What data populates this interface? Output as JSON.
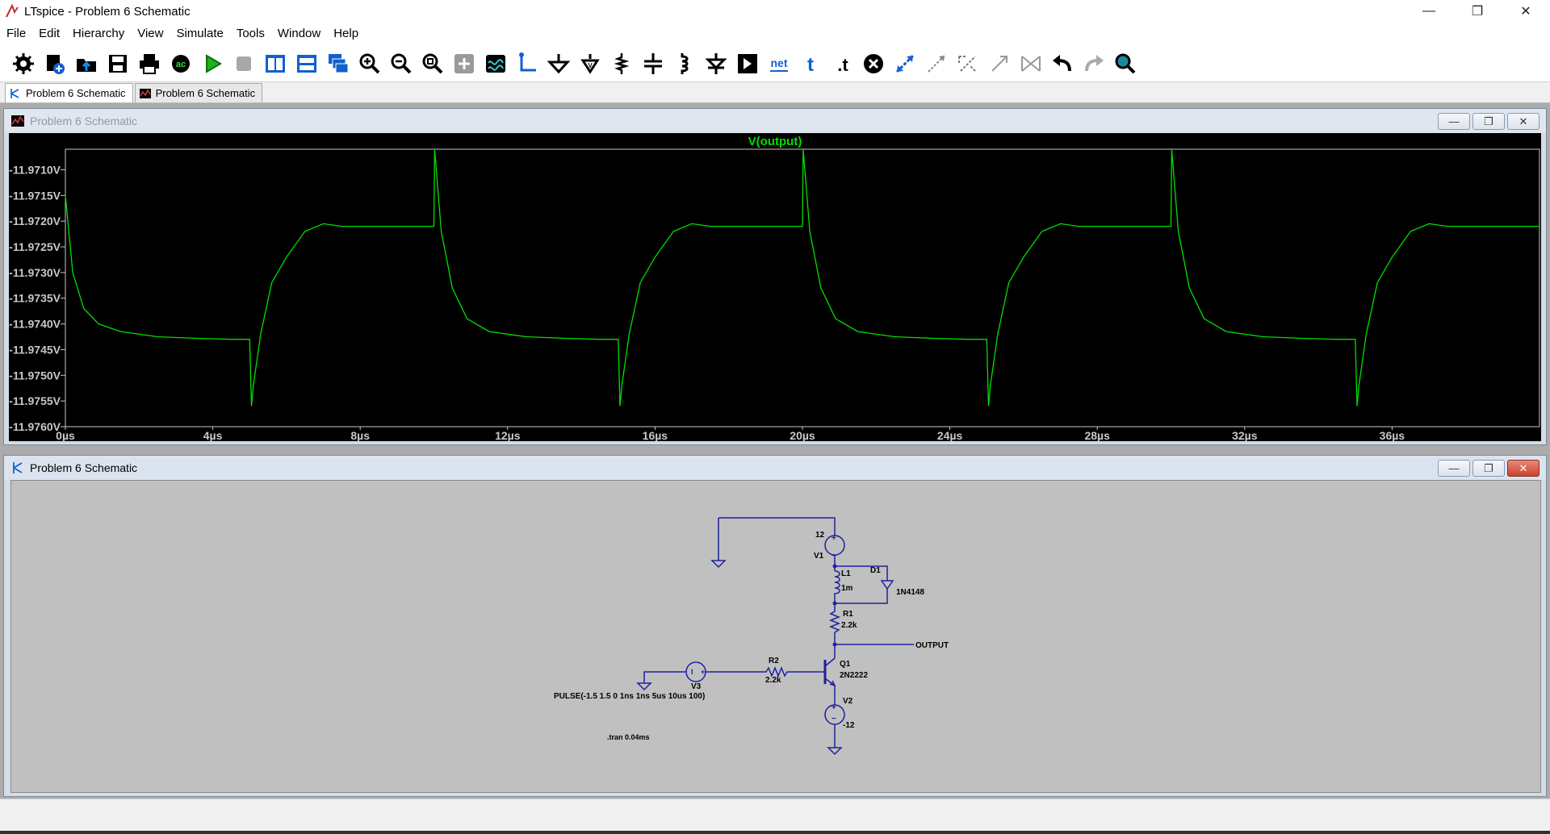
{
  "window": {
    "title": "LTspice - Problem 6 Schematic"
  },
  "menu": [
    "File",
    "Edit",
    "Hierarchy",
    "View",
    "Simulate",
    "Tools",
    "Window",
    "Help"
  ],
  "toolbar": [
    {
      "name": "settings-icon"
    },
    {
      "name": "new-schematic-icon"
    },
    {
      "name": "open-icon"
    },
    {
      "name": "save-icon"
    },
    {
      "name": "print-icon"
    },
    {
      "name": "ac-analysis-icon"
    },
    {
      "name": "run-icon"
    },
    {
      "name": "halt-icon"
    },
    {
      "name": "tile-vertical-icon"
    },
    {
      "name": "tile-horizontal-icon"
    },
    {
      "name": "cascade-icon"
    },
    {
      "name": "zoom-in-icon"
    },
    {
      "name": "zoom-out-icon"
    },
    {
      "name": "zoom-fit-icon"
    },
    {
      "name": "pan-icon"
    },
    {
      "name": "autorange-icon"
    },
    {
      "name": "wire-icon"
    },
    {
      "name": "ground-icon"
    },
    {
      "name": "label-net-icon"
    },
    {
      "name": "resistor-icon"
    },
    {
      "name": "capacitor-icon"
    },
    {
      "name": "inductor-icon"
    },
    {
      "name": "diode-icon"
    },
    {
      "name": "component-icon"
    },
    {
      "name": "net-icon"
    },
    {
      "name": "text-icon"
    },
    {
      "name": "spice-directive-icon"
    },
    {
      "name": "delete-icon"
    },
    {
      "name": "move-icon"
    },
    {
      "name": "drag-icon"
    },
    {
      "name": "rotate-icon"
    },
    {
      "name": "mirror-icon"
    },
    {
      "name": "paste-icon"
    },
    {
      "name": "undo-icon"
    },
    {
      "name": "redo-icon"
    },
    {
      "name": "find-icon"
    }
  ],
  "tabs": [
    {
      "label": "Problem 6 Schematic",
      "kind": "schematic"
    },
    {
      "label": "Problem 6 Schematic",
      "kind": "waveform"
    }
  ],
  "plot_window": {
    "title": "Problem 6 Schematic"
  },
  "schematic_window": {
    "title": "Problem 6 Schematic"
  },
  "chart_data": {
    "type": "line",
    "title": "V(output)",
    "series_color": "#00e000",
    "x_ticks": [
      "0µs",
      "4µs",
      "8µs",
      "12µs",
      "16µs",
      "20µs",
      "24µs",
      "28µs",
      "32µs",
      "36µs"
    ],
    "y_ticks": [
      "-11.9710V",
      "-11.9715V",
      "-11.9720V",
      "-11.9725V",
      "-11.9730V",
      "-11.9735V",
      "-11.9740V",
      "-11.9745V",
      "-11.9750V",
      "-11.9755V",
      "-11.9760V"
    ],
    "xlim": [
      0,
      40
    ],
    "ylim": [
      -11.976,
      -11.9706
    ],
    "series": [
      {
        "x": [
          0,
          0.2,
          0.5,
          0.9,
          1.5,
          2.5,
          3.5,
          4.5,
          5.0,
          5.05,
          5.1,
          5.3,
          5.6,
          6.0,
          6.5,
          7.0,
          7.5,
          8.0,
          9.0,
          10.0,
          10.02,
          10.2,
          10.5,
          10.9,
          11.5,
          12.5,
          13.5,
          14.5,
          15.0,
          15.05,
          15.1,
          15.3,
          15.6,
          16.0,
          16.5,
          17.0,
          17.5,
          18.0,
          19.0,
          20.0,
          20.02,
          20.2,
          20.5,
          20.9,
          21.5,
          22.5,
          23.5,
          24.5,
          25.0,
          25.05,
          25.1,
          25.3,
          25.6,
          26.0,
          26.5,
          27.0,
          27.5,
          28.0,
          29.0,
          30.0,
          30.02,
          30.2,
          30.5,
          30.9,
          31.5,
          32.5,
          33.5,
          34.5,
          35.0,
          35.05,
          35.1,
          35.3,
          35.6,
          36.0,
          36.5,
          37.0,
          37.5,
          38.0,
          39.0,
          40.0
        ],
        "y": [
          -11.9715,
          -11.973,
          -11.9737,
          -11.974,
          -11.97415,
          -11.97425,
          -11.97428,
          -11.9743,
          -11.9743,
          -11.9756,
          -11.9752,
          -11.9742,
          -11.9732,
          -11.9727,
          -11.9722,
          -11.97205,
          -11.9721,
          -11.9721,
          -11.9721,
          -11.9721,
          -11.9706,
          -11.9722,
          -11.9733,
          -11.9739,
          -11.97415,
          -11.97425,
          -11.97428,
          -11.9743,
          -11.9743,
          -11.9756,
          -11.9752,
          -11.9742,
          -11.9732,
          -11.9727,
          -11.9722,
          -11.97205,
          -11.9721,
          -11.9721,
          -11.9721,
          -11.9721,
          -11.9706,
          -11.9722,
          -11.9733,
          -11.9739,
          -11.97415,
          -11.97425,
          -11.97428,
          -11.9743,
          -11.9743,
          -11.9756,
          -11.9752,
          -11.9742,
          -11.9732,
          -11.9727,
          -11.9722,
          -11.97205,
          -11.9721,
          -11.9721,
          -11.9721,
          -11.9721,
          -11.9706,
          -11.9722,
          -11.9733,
          -11.9739,
          -11.97415,
          -11.97425,
          -11.97428,
          -11.9743,
          -11.9743,
          -11.9756,
          -11.9752,
          -11.9742,
          -11.9732,
          -11.9727,
          -11.9722,
          -11.97205,
          -11.9721,
          -11.9721,
          -11.9721,
          -11.9721
        ]
      }
    ]
  },
  "schematic": {
    "labels": {
      "v1_value": "12",
      "v1_name": "V1",
      "l1_name": "L1",
      "l1_value": "1m",
      "d1_name": "D1",
      "d1_model": "1N4148",
      "r1_name": "R1",
      "r1_value": "2.2k",
      "output_net": "OUTPUT",
      "q1_name": "Q1",
      "q1_model": "2N2222",
      "r2_name": "R2",
      "r2_value": "2.2k",
      "v3_name": "V3",
      "v3_value": "PULSE(-1.5 1.5 0 1ns 1ns 5us 10us 100)",
      "v2_name": "V2",
      "v2_value": "-12",
      "directive": ".tran 0.04ms"
    }
  }
}
